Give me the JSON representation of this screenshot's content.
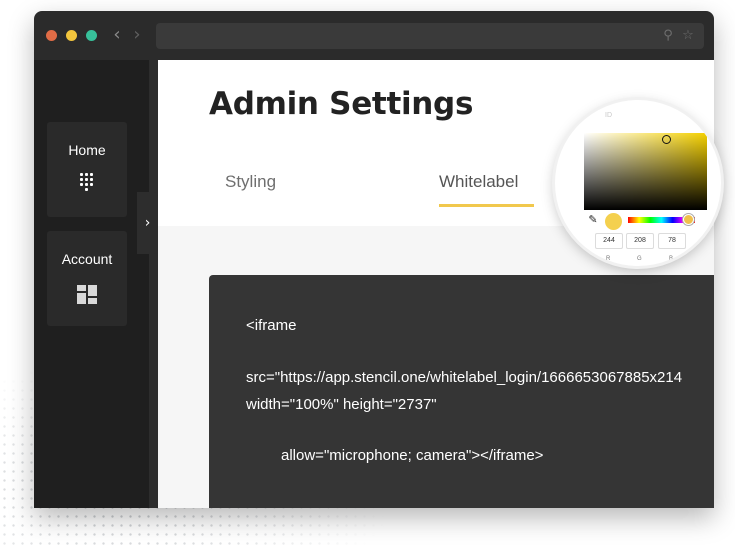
{
  "window": {
    "traffic_lights": [
      "close",
      "minimize",
      "maximize"
    ],
    "colors": {
      "close": "#e06c46",
      "minimize": "#f2c53d",
      "maximize": "#37c09a"
    }
  },
  "sidebar": {
    "items": [
      {
        "label": "Home",
        "icon": "dialpad-icon"
      },
      {
        "label": "Account",
        "icon": "dashboard-grid-icon"
      }
    ],
    "toggle_icon": "chevron-right-icon"
  },
  "main": {
    "title": "Admin Settings",
    "tabs": [
      {
        "label": "Styling",
        "active": false
      },
      {
        "label": "Whitelabel",
        "active": true
      }
    ],
    "accent_color": "#f1c84d"
  },
  "code": {
    "lines": [
      "<iframe",
      "src=\"https://app.stencil.one/whitelabel_login/1666653067885x214",
      "width=\"100%\" height=\"2737\"",
      "allow=\"microphone; camera\"></iframe>"
    ]
  },
  "color_picker": {
    "hint": "ID",
    "selected_color": "#f4d04e",
    "r": "244",
    "g": "208",
    "b": "78",
    "labels": {
      "r": "R",
      "g": "G",
      "b": "B"
    }
  }
}
